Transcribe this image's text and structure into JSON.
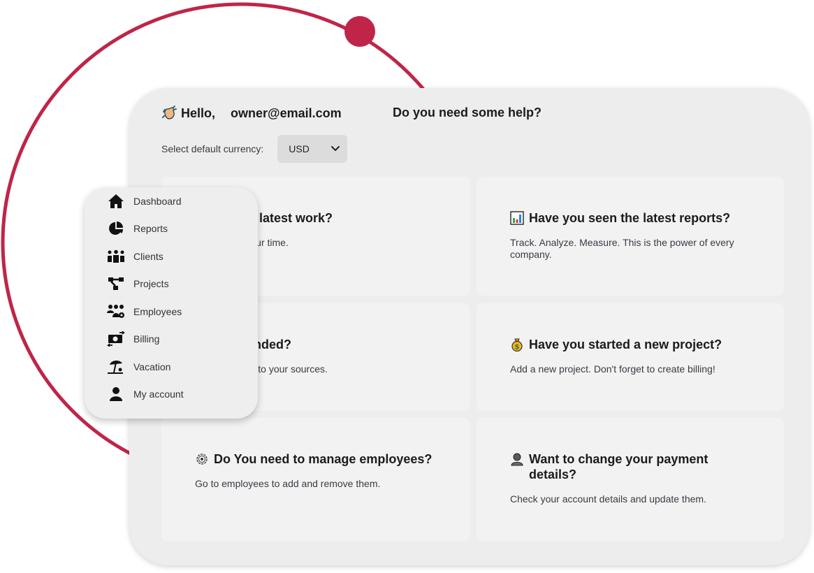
{
  "header": {
    "greeting": "Hello,",
    "user_email": "owner@email.com",
    "help_title": "Do you need some help?"
  },
  "currency": {
    "label": "Select default currency:",
    "selected": "USD"
  },
  "sidebar": {
    "items": [
      {
        "label": "Dashboard",
        "icon": "home-icon"
      },
      {
        "label": "Reports",
        "icon": "pie-chart-icon"
      },
      {
        "label": "Clients",
        "icon": "people-group-icon"
      },
      {
        "label": "Projects",
        "icon": "diagram-project-icon"
      },
      {
        "label": "Employees",
        "icon": "users-gear-icon"
      },
      {
        "label": "Billing",
        "icon": "money-bill-transfer-icon"
      },
      {
        "label": "Vacation",
        "icon": "umbrella-beach-icon"
      },
      {
        "label": "My account",
        "icon": "user-icon"
      }
    ]
  },
  "cards": [
    {
      "title": "o log your latest work?",
      "description": "k and track your time.",
      "emoji": "hidden"
    },
    {
      "title": "Have you seen the latest reports?",
      "description": "Track. Analyze. Measure. This is the power of every company.",
      "emoji": "bar-chart-emoji"
    },
    {
      "title": "ent just landed?",
      "description": "ent. Add them to your sources.",
      "emoji": "hidden"
    },
    {
      "title": "Have you started a new project?",
      "description": "Add a new project. Don't forget to create billing!",
      "emoji": "money-bag-emoji"
    },
    {
      "title": "Do You need to manage employees?",
      "description": "Go to employees to add and remove them.",
      "emoji": "gear-emoji"
    },
    {
      "title": "Want to change your payment details?",
      "description": "Check your account details and update them.",
      "emoji": "person-emoji"
    }
  ],
  "colors": {
    "accent": "#bf2549",
    "window_bg": "#ededed",
    "card_bg": "#f2f2f2",
    "select_bg": "#dcdcdc"
  }
}
